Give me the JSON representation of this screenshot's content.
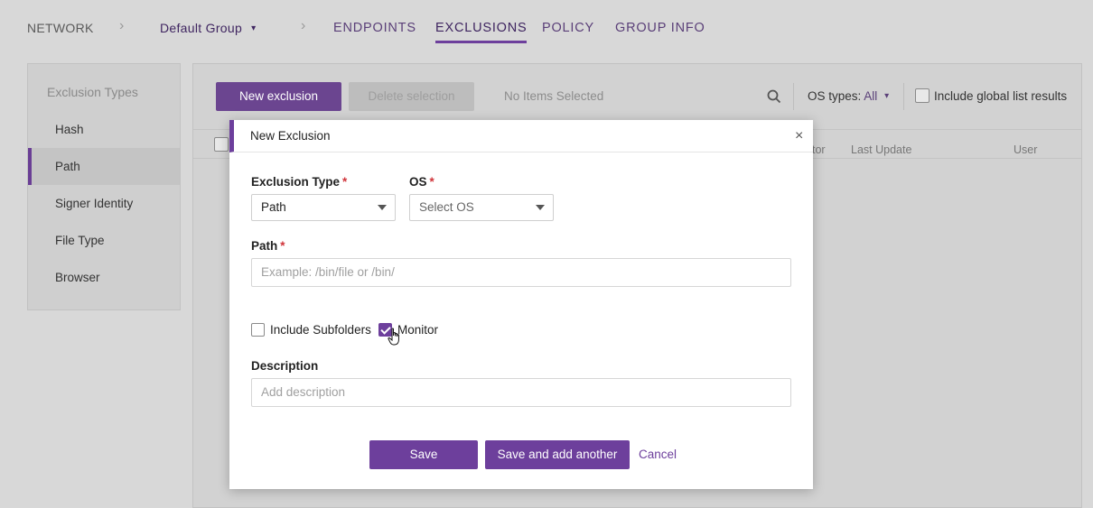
{
  "nav": {
    "breadcrumb": [
      "NETWORK",
      "Default Group"
    ],
    "tabs": [
      "ENDPOINTS",
      "EXCLUSIONS",
      "POLICY",
      "GROUP INFO"
    ],
    "active_tab": "EXCLUSIONS"
  },
  "sidebar": {
    "heading": "Exclusion Types",
    "items": [
      "Hash",
      "Path",
      "Signer Identity",
      "File Type",
      "Browser"
    ],
    "active_item": "Path"
  },
  "toolbar": {
    "new_label": "New exclusion",
    "delete_label": "Delete selection",
    "status": "No Items Selected",
    "os_label": "OS types:",
    "os_value": "All",
    "global_label": "Include global list results"
  },
  "table": {
    "columns_visible": [
      "tor",
      "Last Update",
      "User"
    ]
  },
  "modal": {
    "title": "New Exclusion",
    "exclusion_type_label": "Exclusion Type",
    "exclusion_type_value": "Path",
    "os_label": "OS",
    "os_placeholder": "Select OS",
    "path_label": "Path",
    "path_placeholder": "Example: /bin/file or /bin/",
    "include_subfolders_label": "Include Subfolders",
    "include_subfolders_checked": false,
    "monitor_label": "Monitor",
    "monitor_checked": true,
    "description_label": "Description",
    "description_placeholder": "Add description",
    "save_label": "Save",
    "save_another_label": "Save and add another",
    "cancel_label": "Cancel",
    "required_mark": "*",
    "close_symbol": "×"
  },
  "colors": {
    "accent": "#6d3f9c",
    "required": "#d0343a"
  }
}
